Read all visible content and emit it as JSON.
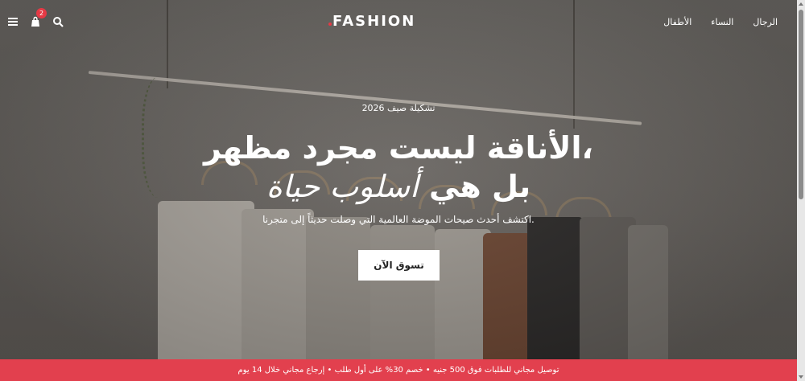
{
  "header": {
    "logo": "FASHION",
    "cart_count": "2",
    "nav": [
      "الرجال",
      "النساء",
      "الأطفال"
    ],
    "icons": [
      "menu-icon",
      "cart-icon",
      "search-icon"
    ]
  },
  "hero": {
    "eyebrow": "تشكيلة صيف 2026",
    "title_line1": "الأناقة ليست مجرد مظهر،",
    "title_line2_normal": "بل هي",
    "title_line2_italic": "أسلوب حياة",
    "subtitle": "اكتشف أحدث صيحات الموضة العالمية التي وصلت حديثاً إلى متجرنا.",
    "cta": "تسوق الآن"
  },
  "promo": {
    "text": "توصيل مجاني للطلبات فوق 500 جنيه • خصم 30% على أول طلب • إرجاع مجاني خلال 14 يوم"
  },
  "colors": {
    "accent": "#e2404e",
    "text": "#ffffff"
  }
}
